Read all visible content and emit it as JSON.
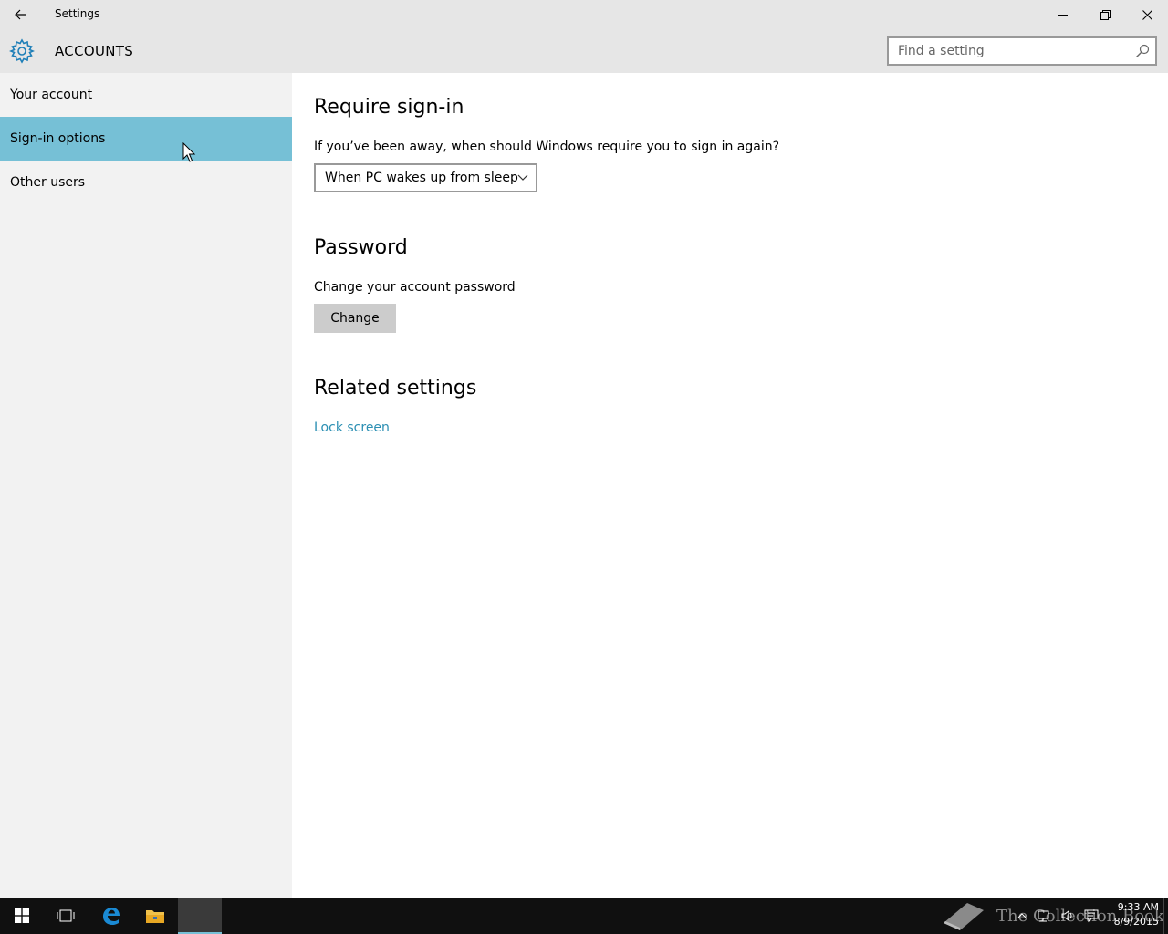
{
  "window": {
    "title": "Settings",
    "back_icon": "back-arrow-icon",
    "controls": [
      "minimize-icon",
      "restore-icon",
      "close-icon"
    ]
  },
  "header": {
    "icon": "gear-icon",
    "title": "ACCOUNTS",
    "search_placeholder": "Find a setting",
    "search_icon": "search-icon"
  },
  "sidebar": {
    "items": [
      {
        "label": "Your account",
        "selected": false
      },
      {
        "label": "Sign-in options",
        "selected": true
      },
      {
        "label": "Other users",
        "selected": false
      }
    ]
  },
  "main": {
    "require_signin": {
      "heading": "Require sign-in",
      "question": "If you’ve been away, when should Windows require you to sign in again?",
      "dropdown_value": "When PC wakes up from sleep"
    },
    "password": {
      "heading": "Password",
      "description": "Change your account password",
      "button_label": "Change"
    },
    "related": {
      "heading": "Related settings",
      "link_label": "Lock screen"
    }
  },
  "taskbar": {
    "watermark": "The Collection Book",
    "time": "9:33 AM",
    "date": "8/9/2015"
  },
  "colors": {
    "accent": "#76c0d6",
    "link": "#2b8fb3",
    "header_bg": "#e6e6e6",
    "sidebar_bg": "#f2f2f2"
  }
}
